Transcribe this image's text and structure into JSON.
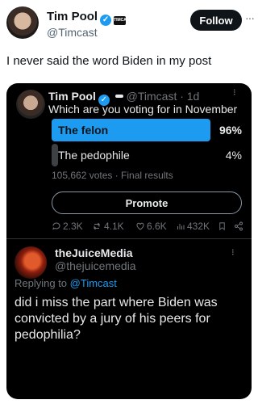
{
  "outer": {
    "name": "Tim Pool",
    "affiliate_badge": "TIMCAST",
    "handle": "@Timcast",
    "follow_label": "Follow",
    "more_label": "···",
    "text": "I never said the word Biden in my post"
  },
  "quoted": {
    "name": "Tim Pool",
    "handle": "@Timcast · 1d",
    "question": "Which are you voting for in November",
    "poll": [
      {
        "label": "The felon",
        "percent_label": "96%",
        "percent": 96
      },
      {
        "label": "The pedophile",
        "percent_label": "4%",
        "percent": 4
      }
    ],
    "poll_meta": "105,662 votes · Final results",
    "promote_label": "Promote",
    "actions": {
      "replies": "2.3K",
      "reposts": "4.1K",
      "likes": "6.6K",
      "views": "432K"
    }
  },
  "reply": {
    "name": "theJuiceMedia",
    "handle": "@thejuicemedia",
    "replying_prefix": "Replying to",
    "replying_to": "@Timcast",
    "text": "did i miss the part where Biden was convicted by a jury of his peers for pedophilia?"
  },
  "colors": {
    "accent": "#1d9bf0",
    "winner_bar": "#1d9bf0",
    "loser_bar": "#3e4144"
  }
}
